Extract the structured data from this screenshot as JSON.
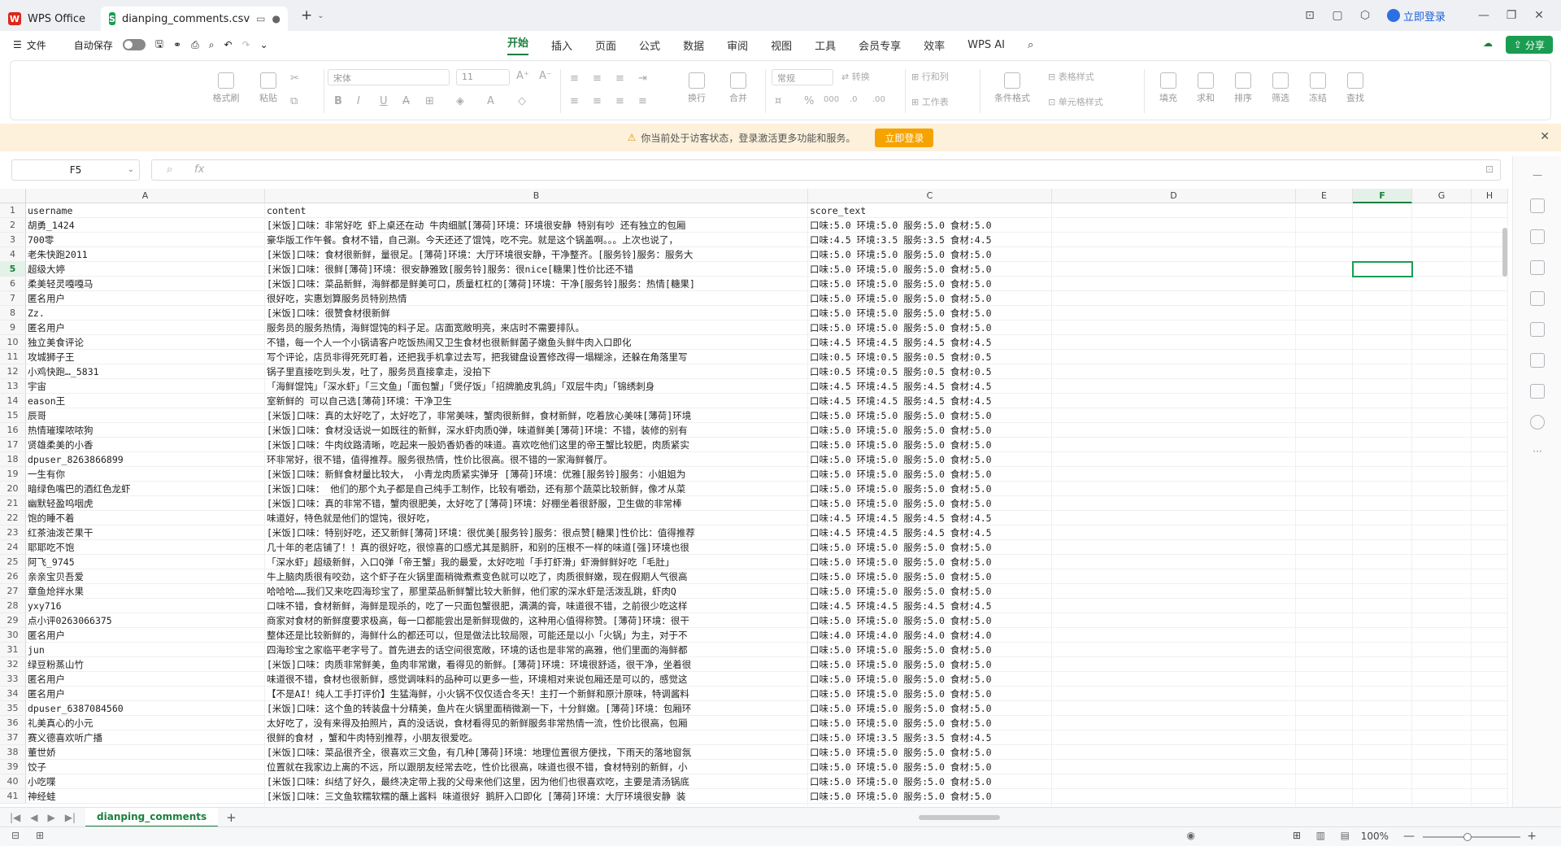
{
  "titlebar": {
    "home_tab": "WPS Office",
    "file_tab": "dianping_comments.csv",
    "new_tab": "+",
    "login": "立即登录"
  },
  "menubar": {
    "file": "文件",
    "autosave": "自动保存",
    "tabs": [
      "开始",
      "插入",
      "页面",
      "公式",
      "数据",
      "审阅",
      "视图",
      "工具",
      "会员专享",
      "效率",
      "WPS AI"
    ],
    "active_tab": "开始",
    "share": "分享"
  },
  "ribbon": {
    "format_painter": "格式刷",
    "paste": "粘贴",
    "font_name": "宋体",
    "font_size": "11",
    "wrap": "换行",
    "merge": "合并",
    "number_format": "常规",
    "convert": "转换",
    "row_col": "行和列",
    "worksheet": "工作表",
    "cond_format": "条件格式",
    "table_style": "表格样式",
    "cell_style": "单元格样式",
    "fill": "填充",
    "sum": "求和",
    "sort": "排序",
    "filter": "筛选",
    "freeze": "冻结",
    "find": "查找"
  },
  "notice": {
    "text": "你当前处于访客状态，登录激活更多功能和服务。",
    "button": "立即登录"
  },
  "formula": {
    "cell_ref": "F5",
    "fx": "fx",
    "content": ""
  },
  "grid": {
    "columns": [
      "A",
      "B",
      "C",
      "D",
      "E",
      "F",
      "G",
      "H"
    ],
    "selected_col": "F",
    "selected_row": 5,
    "rows": [
      [
        "username",
        "content",
        "score_text"
      ],
      [
        "胡勇_1424",
        "[米饭]口味：非常好吃 虾上桌还在动 牛肉细腻[薄荷]环境：环境很安静 特别有吵 还有独立的包厢",
        "口味:5.0 环境:5.0 服务:5.0 食材:5.0"
      ],
      [
        "700零",
        "豪华版工作午餐。食材不错，自己涮。今天还还了馄饨，吃不完。就是这个锅盖啊。。。上次也说了，",
        "口味:4.5 环境:3.5 服务:3.5 食材:4.5"
      ],
      [
        "老朱快跑2011",
        "[米饭]口味：食材很新鲜，量很足。[薄荷]环境：大厅环境很安静，干净整齐。[服务铃]服务：服务大",
        "口味:5.0 环境:5.0 服务:5.0 食材:5.0"
      ],
      [
        "超级大婷",
        "[米饭]口味：很鲜[薄荷]环境：很安静雅致[服务铃]服务：很nice[糖果]性价比还不错",
        "口味:5.0 环境:5.0 服务:5.0 食材:5.0"
      ],
      [
        "柔美轻灵嘎嘎马",
        "[米饭]口味：菜品新鲜，海鲜都是鲜美可口，质量杠杠的[薄荷]环境：干净[服务铃]服务：热情[糖果]",
        "口味:5.0 环境:5.0 服务:5.0 食材:5.0"
      ],
      [
        "匿名用户",
        "很好吃，实惠划算服务员特别热情",
        "口味:5.0 环境:5.0 服务:5.0 食材:5.0"
      ],
      [
        "Zz.",
        "[米饭]口味：很赞食材很新鲜",
        "口味:5.0 环境:5.0 服务:5.0 食材:5.0"
      ],
      [
        "匿名用户",
        "服务员的服务热情，海鲜馄饨的料子足。店面宽敞明亮，来店时不需要排队。",
        "口味:5.0 环境:5.0 服务:5.0 食材:5.0"
      ],
      [
        "独立美食评论",
        "不错，每一个人一个小锅请客户吃饭热闹又卫生食材也很新鲜菌子嫩鱼头鲜牛肉入口即化",
        "口味:4.5 环境:4.5 服务:4.5 食材:4.5"
      ],
      [
        "攻城狮子王",
        "写个评论，店员非得死死盯着，还把我手机拿过去写，把我键盘设置修改得一塌糊涂，还躲在角落里写",
        "口味:0.5 环境:0.5 服务:0.5 食材:0.5"
      ],
      [
        "小鸡快跑…_5831",
        "锅子里直接吃到头发，吐了，服务员直接拿走，没拍下",
        "口味:0.5 环境:0.5 服务:0.5 食材:0.5"
      ],
      [
        "宇宙",
        "「海鲜馄饨」「深水虾」「三文鱼」「面包蟹」「煲仔饭」「招牌脆皮乳鸽」「双层牛肉」「锦绣刺身",
        "口味:4.5 环境:4.5 服务:4.5 食材:4.5"
      ],
      [
        "eason王",
        "室新鲜的  可以自己选[薄荷]环境：干净卫生",
        "口味:4.5 环境:4.5 服务:4.5 食材:4.5"
      ],
      [
        "辰哥",
        "[米饭]口味：真的太好吃了，太好吃了，非常美味，蟹肉很新鲜，食材新鲜，吃着放心美味[薄荷]环境",
        "口味:5.0 环境:5.0 服务:5.0 食材:5.0"
      ],
      [
        "热情璀璨哝哝狗",
        "[米饭]口味：食材没话说一如既往的新鲜，深水虾肉质Q弹，味道鲜美[薄荷]环境：不错，装修的别有",
        "口味:5.0 环境:5.0 服务:5.0 食材:5.0"
      ],
      [
        "贤雄柔美的小香",
        "[米饭]口味：牛肉纹路清晰，吃起来一股奶香奶香的味道。喜欢吃他们这里的帝王蟹比较肥，肉质紧实",
        "口味:5.0 环境:5.0 服务:5.0 食材:5.0"
      ],
      [
        "dpuser_8263866899",
        "环非常好，很不错，值得推荐。服务很热情，性价比很高。很不错的一家海鲜餐厅。",
        "口味:5.0 环境:5.0 服务:5.0 食材:5.0"
      ],
      [
        "一生有你",
        "[米饭]口味：新鲜食材量比较大， 小青龙肉质紧实弹牙 [薄荷]环境：优雅[服务铃]服务：小姐姐为",
        "口味:5.0 环境:5.0 服务:5.0 食材:5.0"
      ],
      [
        "暗绿色嘴巴的酒红色龙虾",
        "[米饭]口味：  他们的那个丸子都是自己纯手工制作，比较有嚼劲，还有那个蔬菜比较新鲜，像才从菜",
        "口味:5.0 环境:5.0 服务:5.0 食材:5.0"
      ],
      [
        "幽默轻盈呜咽虎",
        "[米饭]口味：真的非常不错，蟹肉很肥美，太好吃了[薄荷]环境：好棚坐着很舒服，卫生做的非常棒",
        "口味:5.0 环境:5.0 服务:5.0 食材:5.0"
      ],
      [
        "饱的睡不着",
        "味道好，特色就是他们的馄饨，很好吃，",
        "口味:4.5 环境:4.5 服务:4.5 食材:4.5"
      ],
      [
        "红茶油泼芒果干",
        "[米饭]口味：特别好吃，还又新鲜[薄荷]环境：很优美[服务铃]服务：很点赞[糖果]性价比：值得推荐",
        "口味:4.5 环境:4.5 服务:4.5 食材:4.5"
      ],
      [
        "耶耶吃不饱",
        "几十年的老店铺了！！真的很好吃，很惊喜的口感尤其是鹅肝，和别的压根不一样的味道[强]环境也很",
        "口味:5.0 环境:5.0 服务:5.0 食材:5.0"
      ],
      [
        "阿飞_9745",
        "「深水虾」超级新鲜，入口Q弹「帝王蟹」我的最爱，太好吃啦「手打虾滑」虾滑鲜鲜好吃「毛肚」",
        "口味:5.0 环境:5.0 服务:5.0 食材:5.0"
      ],
      [
        "亲亲宝贝吾爱",
        "牛上脑肉质很有咬劲，这个虾子在火锅里面稍微煮煮变色就可以吃了，肉质很鲜嫩，现在假期人气很高",
        "口味:5.0 环境:5.0 服务:5.0 食材:5.0"
      ],
      [
        "章鱼炝拌水果",
        "哈哈哈……我们又来吃四海珍宝了，那里菜品新鲜蟹比较大新鲜，他们家的深水虾是活泼乱跳，虾肉Q",
        "口味:5.0 环境:5.0 服务:5.0 食材:5.0"
      ],
      [
        "yxy716",
        "口味不错，食材新鲜，海鲜是现杀的，吃了一只面包蟹很肥，满满的膏，味道很不错，之前很少吃这样",
        "口味:4.5 环境:4.5 服务:4.5 食材:4.5"
      ],
      [
        "点小评0263066375",
        "商家对食材的新鲜度要求极高，每一口都能尝出是新鲜现做的，这种用心值得称赞。[薄荷]环境：很干",
        "口味:5.0 环境:5.0 服务:5.0 食材:5.0"
      ],
      [
        "匿名用户",
        "整体还是比较新鲜的，海鲜什么的都还可以，但是做法比较局限，可能还是以小「火锅」为主，对于不",
        "口味:4.0 环境:4.0 服务:4.0 食材:4.0"
      ],
      [
        "jun",
        "四海珍宝之家临平老字号了。首先进去的话空间很宽敞，环境的话也是非常的高雅，他们里面的海鲜都",
        "口味:5.0 环境:5.0 服务:5.0 食材:5.0"
      ],
      [
        "绿豆粉蒸山竹",
        "[米饭]口味：肉质非常鲜美，鱼肉非常嫩，看得见的新鲜。[薄荷]环境：环境很舒适，很干净，坐着很",
        "口味:5.0 环境:5.0 服务:5.0 食材:5.0"
      ],
      [
        "匿名用户",
        "味道很不错，食材也很新鲜，感觉调味料的品种可以更多一些，环境相对来说包厢还是可以的，感觉这",
        "口味:5.0 环境:5.0 服务:5.0 食材:5.0"
      ],
      [
        "匿名用户",
        "【不是AI！纯人工手打评价】生猛海鲜，小火锅不仅仅适合冬天！主打一个新鲜和原汁原味，特调酱料",
        "口味:5.0 环境:5.0 服务:5.0 食材:5.0"
      ],
      [
        "dpuser_6387084560",
        "[米饭]口味：这个鱼的转装盘十分精美，鱼片在火锅里面稍微涮一下，十分鲜嫩。[薄荷]环境：包厢环",
        "口味:5.0 环境:5.0 服务:5.0 食材:5.0"
      ],
      [
        "礼美真心的小元",
        "太好吃了，没有来得及拍照片，真的没话说，食材看得见的新鲜服务非常热情一流，性价比很高，包厢",
        "口味:5.0 环境:5.0 服务:5.0 食材:5.0"
      ],
      [
        "赛义德喜欢听广播",
        "很鲜的食材  ，蟹和牛肉特别推荐，小朋友很爱吃。",
        "口味:5.0 环境:3.5 服务:3.5 食材:4.5"
      ],
      [
        "董世娇",
        "[米饭]口味：菜品很齐全，很喜欢三文鱼，有几种[薄荷]环境：地理位置很方便找，下雨天的落地窗氛",
        "口味:5.0 环境:5.0 服务:5.0 食材:5.0"
      ],
      [
        "饺子",
        "位置就在我家边上离的不远，所以跟朋友经常去吃，性价比很高，味道也很不错，食材特别的新鲜，小",
        "口味:5.0 环境:5.0 服务:5.0 食材:5.0"
      ],
      [
        "小吃喋",
        "[米饭]口味：纠结了好久，最终决定带上我的父母来他们这里，因为他们也很喜欢吃，主要是清汤锅底",
        "口味:5.0 环境:5.0 服务:5.0 食材:5.0"
      ],
      [
        "神经蛙",
        "[米饭]口味：三文鱼软糯软糯的蘸上酱料 味道很好 鹅肝入口即化 [薄荷]环境：大厅环境很安静 装",
        "口味:5.0 环境:5.0 服务:5.0 食材:5.0"
      ]
    ]
  },
  "sheets": [
    "dianping_comments"
  ],
  "status": {
    "zoom": "100%"
  }
}
